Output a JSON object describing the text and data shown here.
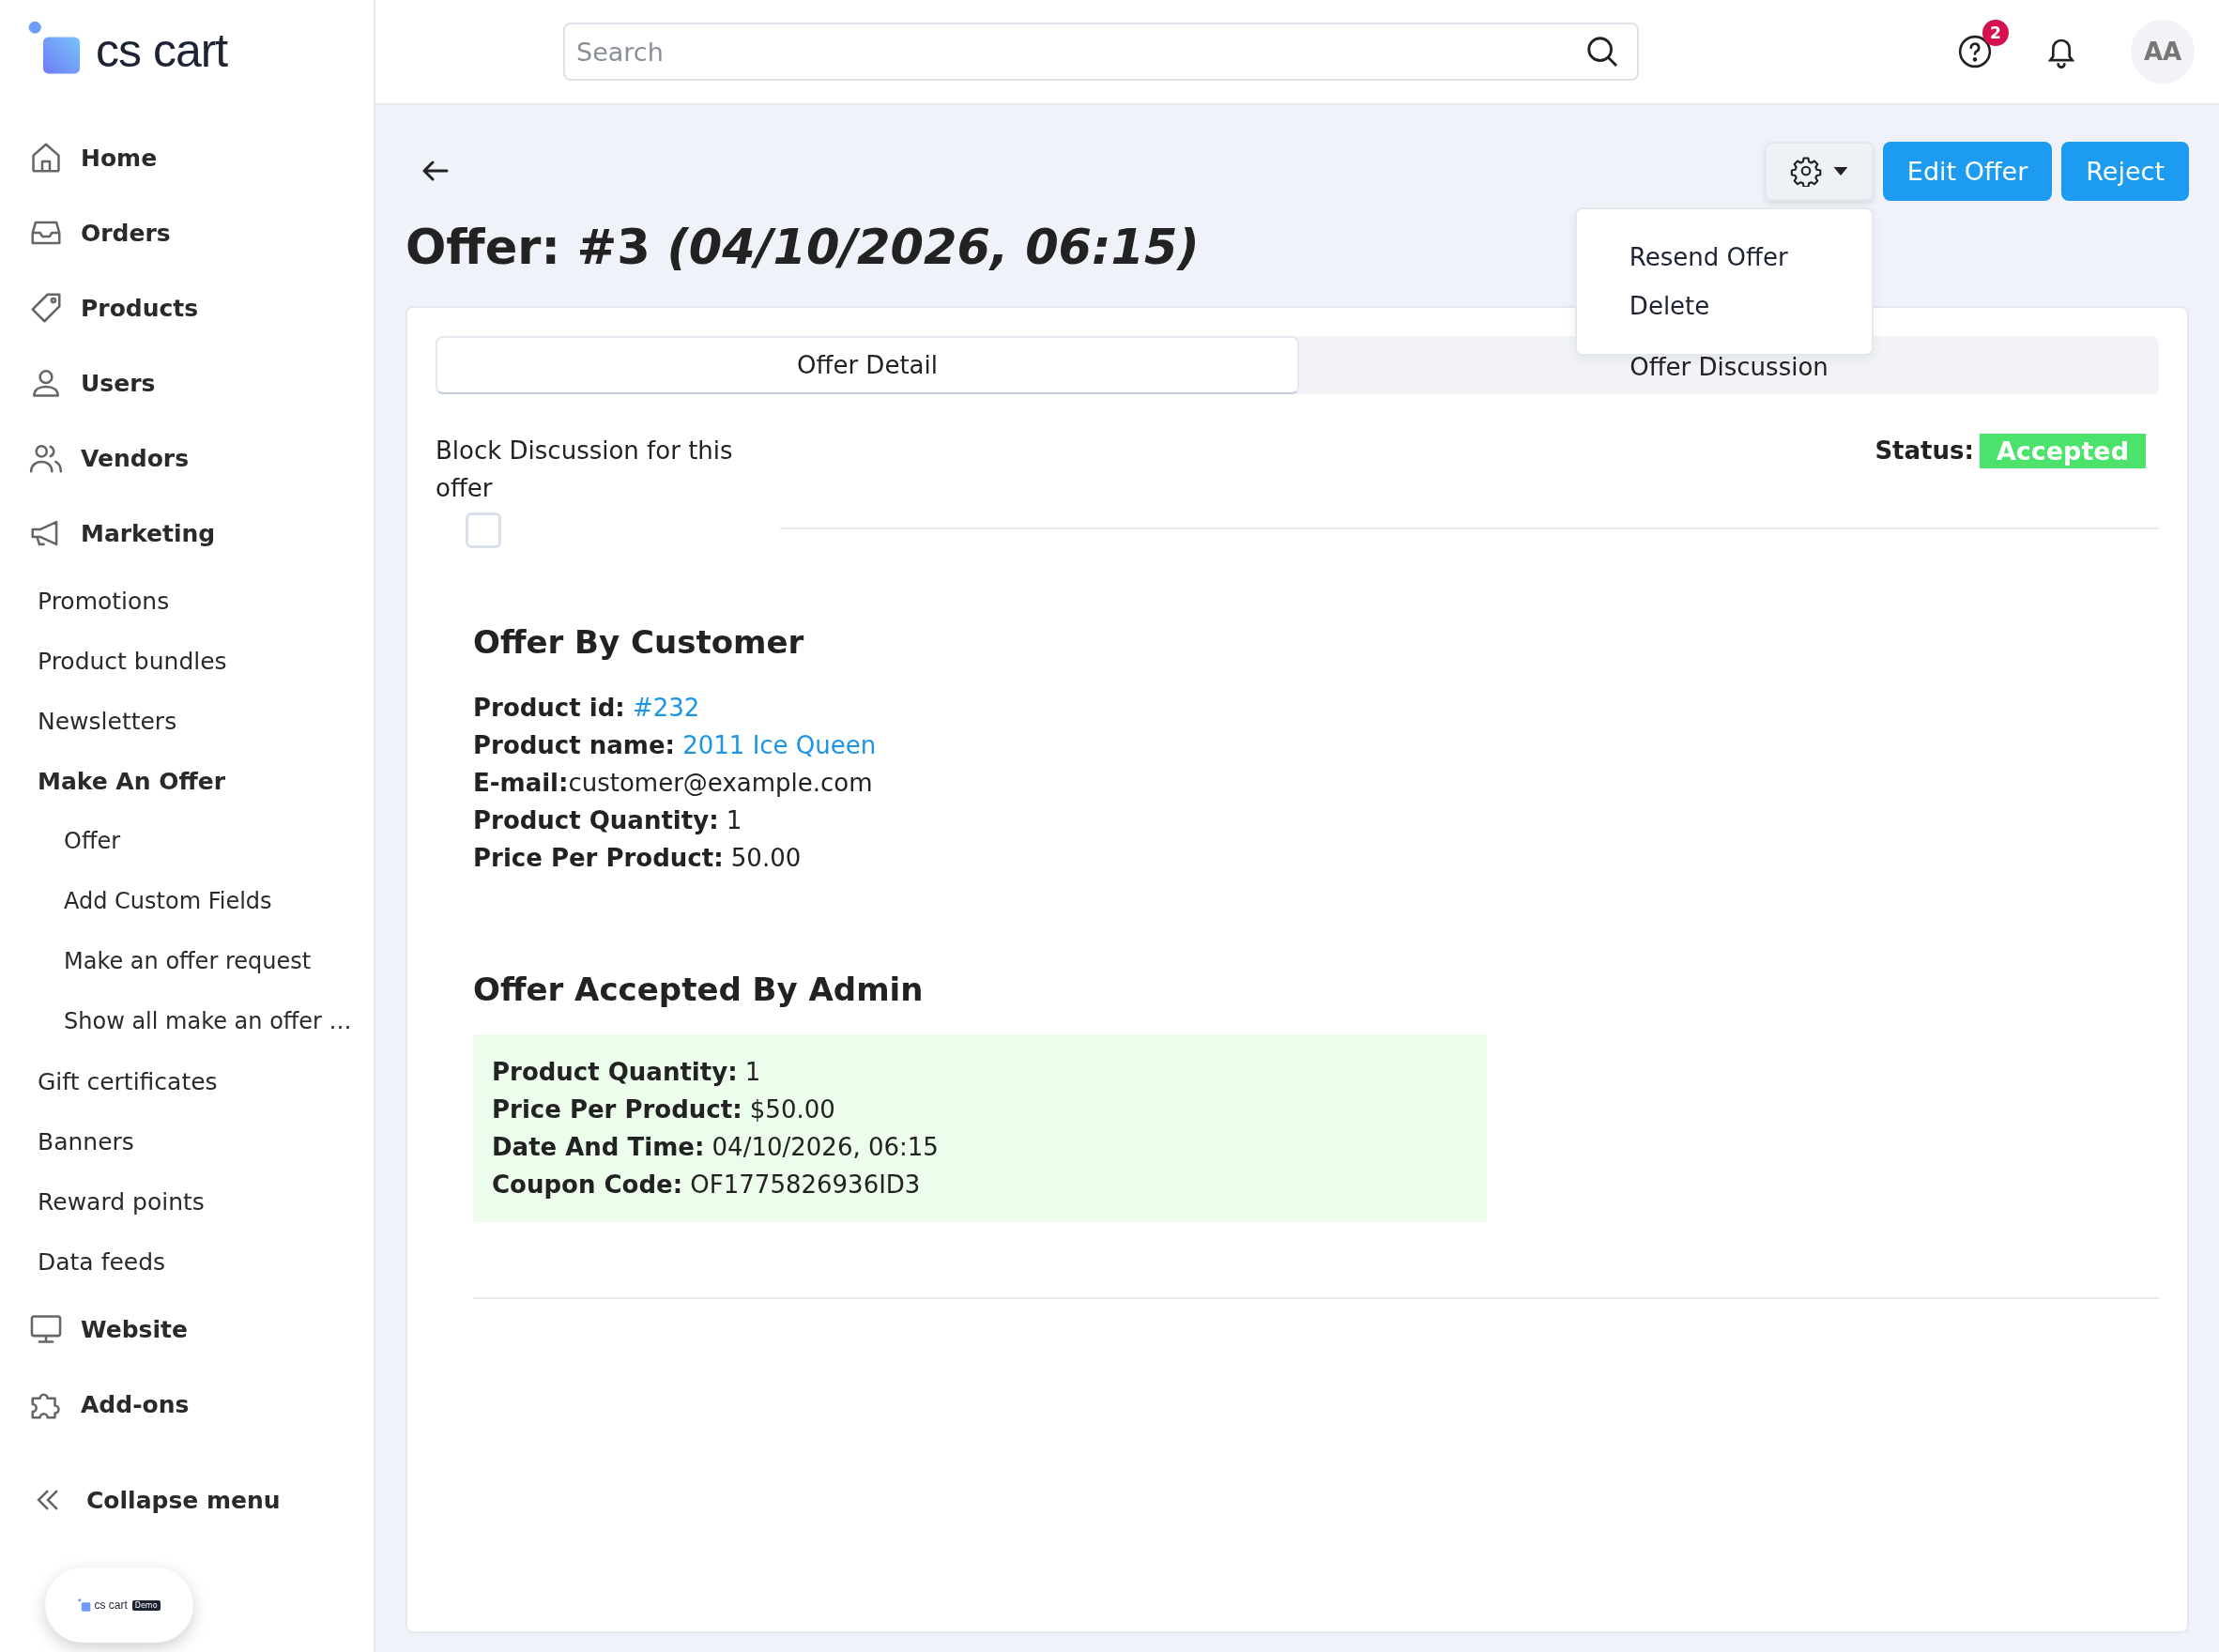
{
  "brand": {
    "name": "cs cart"
  },
  "sidebar": {
    "items": [
      {
        "label": "Home"
      },
      {
        "label": "Orders"
      },
      {
        "label": "Products"
      },
      {
        "label": "Users"
      },
      {
        "label": "Vendors"
      },
      {
        "label": "Marketing",
        "children": [
          {
            "label": "Promotions"
          },
          {
            "label": "Product bundles"
          },
          {
            "label": "Newsletters"
          },
          {
            "label": "Make An Offer",
            "expanded": true,
            "children": [
              {
                "label": "Offer"
              },
              {
                "label": "Add Custom Fields"
              },
              {
                "label": "Make an offer request"
              },
              {
                "label": "Show all make an offer …"
              }
            ]
          },
          {
            "label": "Gift certificates"
          },
          {
            "label": "Banners"
          },
          {
            "label": "Reward points"
          },
          {
            "label": "Data feeds"
          }
        ]
      },
      {
        "label": "Website"
      },
      {
        "label": "Add-ons"
      }
    ],
    "collapse": "Collapse menu",
    "demo_badge": {
      "name": "cs cart",
      "tag": "Demo"
    }
  },
  "topbar": {
    "search": {
      "placeholder": "Search"
    },
    "help_badge": "2",
    "avatar": "AA"
  },
  "page": {
    "title": "Offer: #3 *(04/10/2026, 06:15)*",
    "settings_menu": {
      "open": true,
      "items": [
        "Resend Offer",
        "Delete"
      ]
    },
    "buttons": [
      "Edit Offer",
      "Reject"
    ],
    "tabs": [
      {
        "label": "Offer Detail",
        "selected": true
      },
      {
        "label": "Offer Discussion",
        "selected": false
      }
    ],
    "block_discussion": {
      "label": "Block Discussion for this offer",
      "checked": false
    },
    "status": {
      "label": "Status:",
      "value": "Accepted",
      "color": "#4be36b"
    },
    "sections": [
      {
        "title": "Offer By Customer",
        "highlighted": false,
        "fields": [
          {
            "kind": "link",
            "label": "Product id:",
            "value": "#232"
          },
          {
            "kind": "link",
            "label": "Product name:",
            "value": "2011 Ice Queen"
          },
          {
            "kind": "text",
            "text": "**E-mail:**customer@example.com"
          },
          {
            "kind": "text",
            "text": "**Product Quantity:** 1"
          },
          {
            "kind": "text",
            "text": "**Price Per Product:** 50.00"
          }
        ]
      },
      {
        "title": "Offer Accepted By Admin",
        "highlighted": true,
        "fields": [
          {
            "kind": "text",
            "text": "**Product Quantity:** 1"
          },
          {
            "kind": "text",
            "text": "**Price Per Product:** $50.00"
          },
          {
            "kind": "text",
            "text": "**Date And Time:** 04/10/2026, 06:15"
          },
          {
            "kind": "text",
            "text": "**Coupon Code:** OF1775826936ID3"
          }
        ]
      }
    ]
  }
}
